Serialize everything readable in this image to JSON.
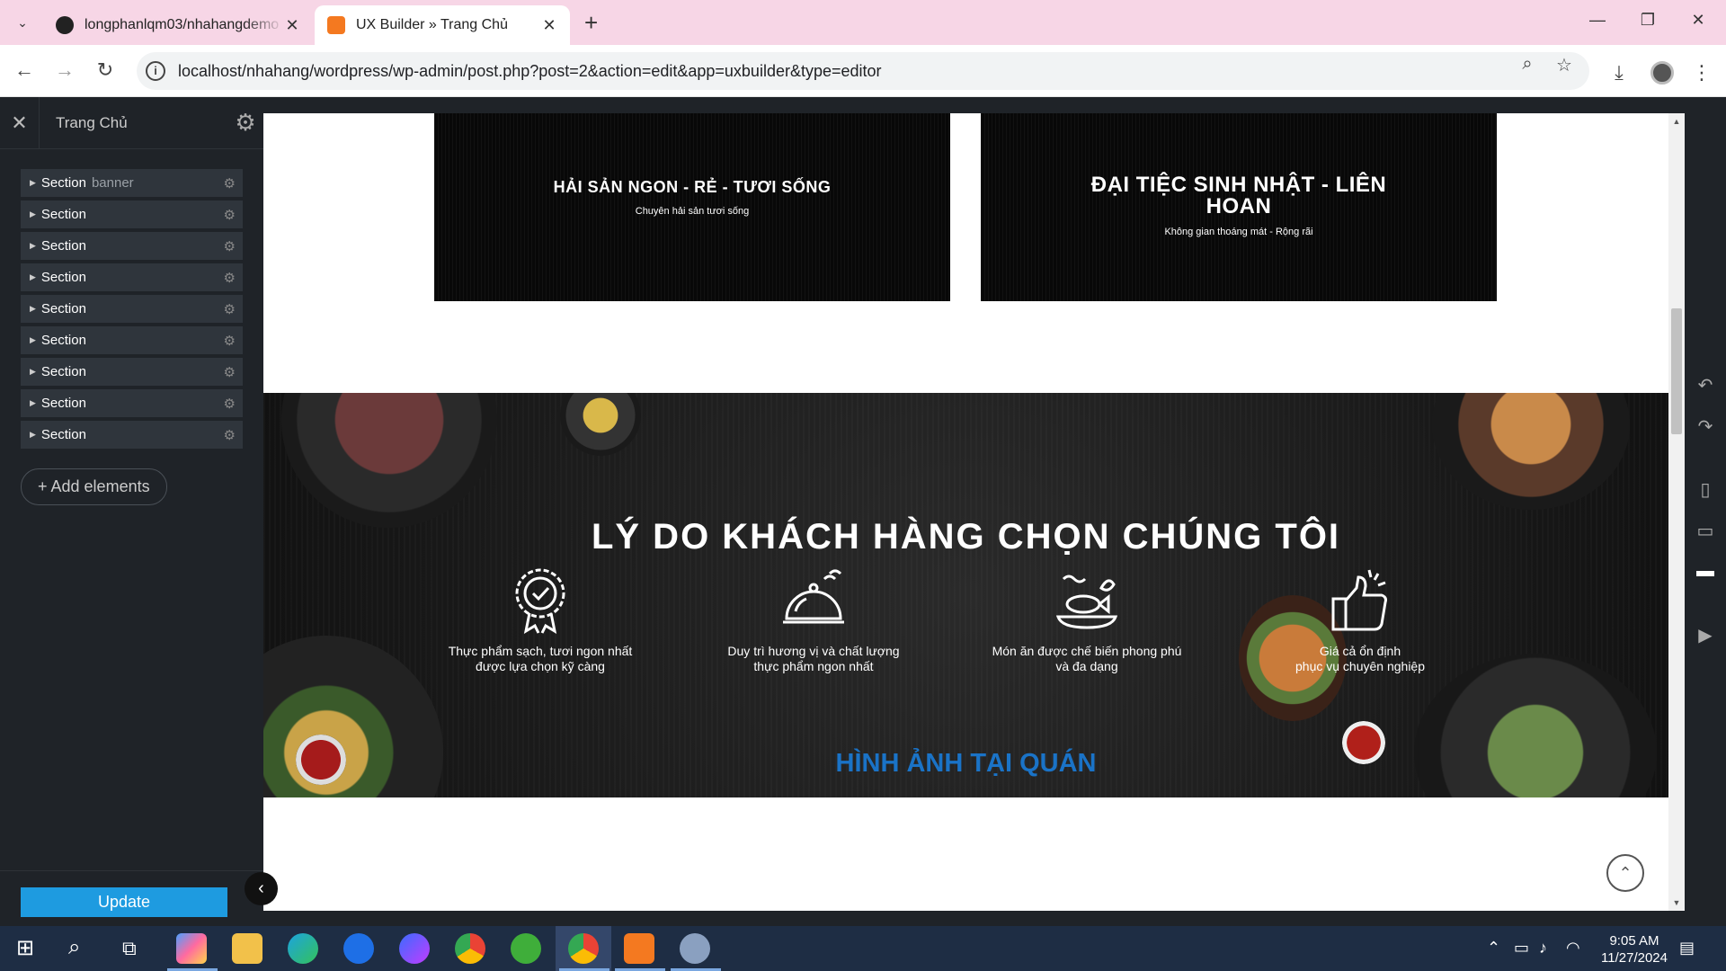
{
  "browser": {
    "tabs": [
      {
        "title": "longphanlqm03/nhahangdemo",
        "favicon": "github-icon",
        "active": false
      },
      {
        "title": "UX Builder » Trang Chủ",
        "favicon": "xampp-icon",
        "active": true
      }
    ],
    "url": "localhost/nhahang/wordpress/wp-admin/post.php?post=2&action=edit&app=uxbuilder&type=editor"
  },
  "sidebar": {
    "title": "Trang Chủ",
    "items": [
      {
        "label": "Section",
        "tag": "banner"
      },
      {
        "label": "Section",
        "tag": ""
      },
      {
        "label": "Section",
        "tag": ""
      },
      {
        "label": "Section",
        "tag": ""
      },
      {
        "label": "Section",
        "tag": ""
      },
      {
        "label": "Section",
        "tag": ""
      },
      {
        "label": "Section",
        "tag": ""
      },
      {
        "label": "Section",
        "tag": ""
      },
      {
        "label": "Section",
        "tag": ""
      }
    ],
    "add_label": "+ Add elements",
    "update_label": "Update"
  },
  "canvas": {
    "banners": [
      {
        "heading": "HẢI SẢN NGON - RẺ - TƯƠI SỐNG",
        "sub": "Chuyên hải sản tươi sống"
      },
      {
        "heading": "ĐẠI TIỆC SINH NHẬT - LIÊN HOAN",
        "sub": "Không gian thoáng mát - Rộng rãi"
      }
    ],
    "reasons_title": "LÝ DO KHÁCH HÀNG CHỌN CHÚNG TÔI",
    "reasons": [
      {
        "icon": "award-badge-icon",
        "line1": "Thực phẩm sạch, tươi ngon nhất",
        "line2": "được lựa chọn kỹ càng"
      },
      {
        "icon": "food-cloche-icon",
        "line1": "Duy trì hương vị và chất lượng",
        "line2": "thực phẩm ngon nhất"
      },
      {
        "icon": "fish-dish-icon",
        "line1": "Món ăn được chế biến phong phú",
        "line2": "và đa dạng"
      },
      {
        "icon": "thumbs-up-icon",
        "line1": "Giá cả ổn định",
        "line2": "phục vụ chuyên nghiệp"
      }
    ],
    "gallery_title": "HÌNH ẢNH TẠI QUÁN"
  },
  "taskbar": {
    "time": "9:05 AM",
    "date": "11/27/2024"
  },
  "colors": {
    "accent": "#1e9be0",
    "gallery_title": "#1a73c7",
    "sidebar_bg": "#1f2328",
    "tab_bar": "#f7d6e6"
  }
}
